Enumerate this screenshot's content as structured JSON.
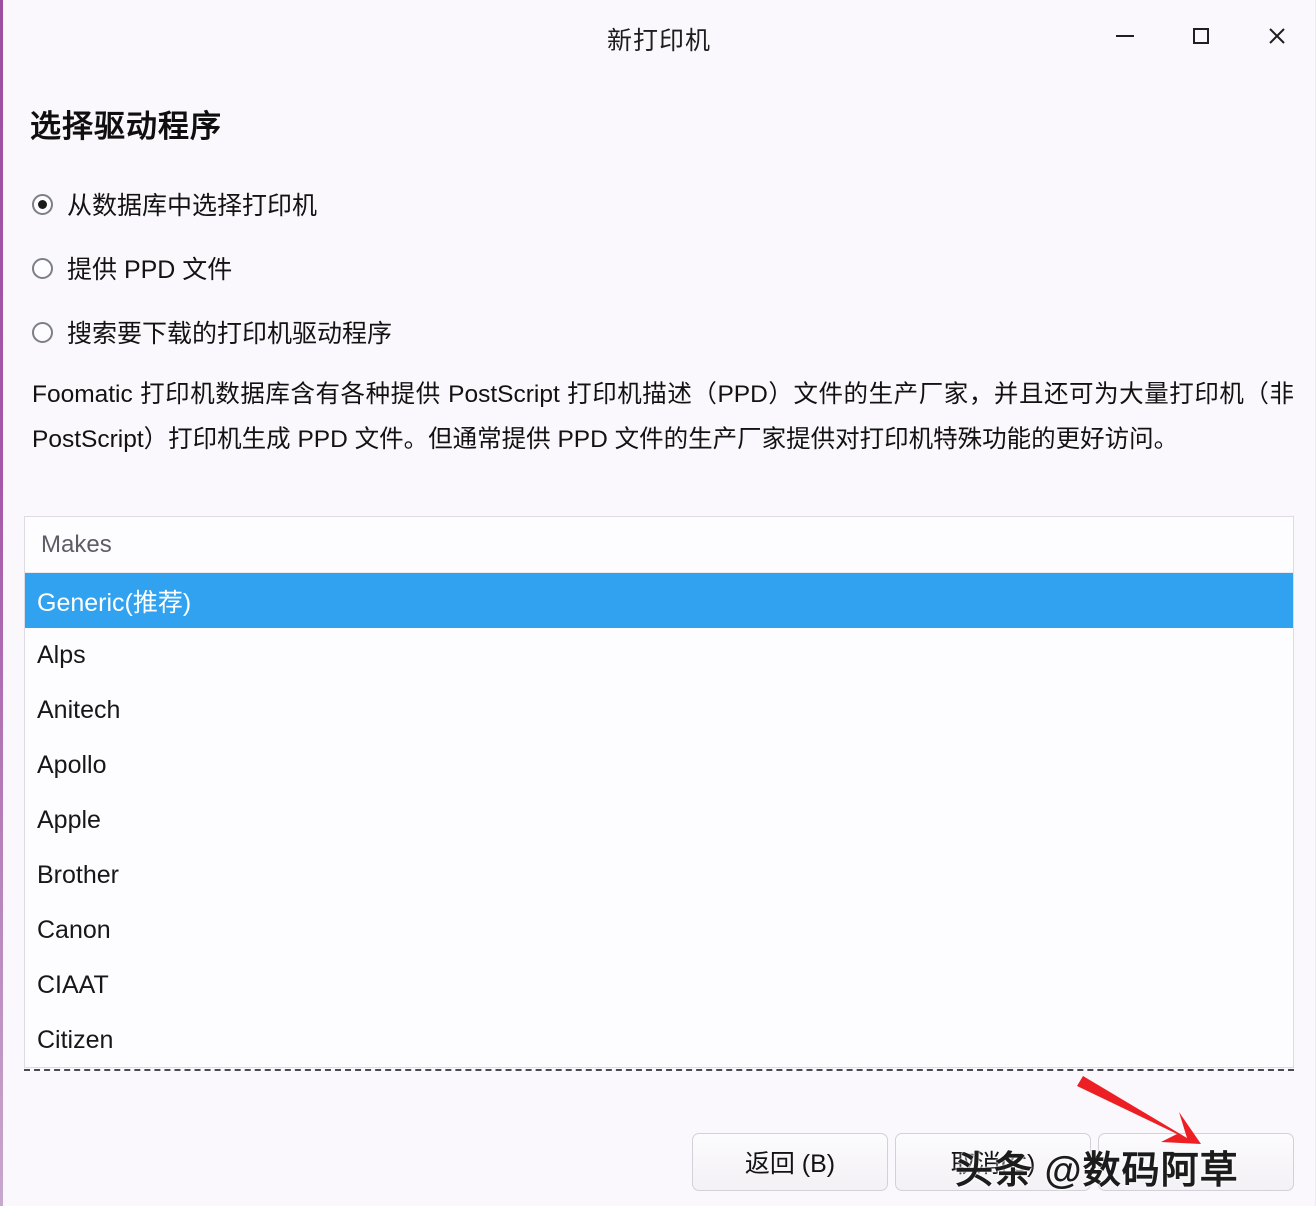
{
  "window": {
    "title": "新打印机",
    "controls": [
      {
        "name": "minimize",
        "glyph": "−"
      },
      {
        "name": "maximize",
        "glyph": "□"
      },
      {
        "name": "close",
        "glyph": "×"
      }
    ],
    "accent_edge_color": "#9b4f9e",
    "background_color": "#faf8fc"
  },
  "page": {
    "heading": "选择驱动程序",
    "description": "Foomatic 打印机数据库含有各种提供 PostScript 打印机描述（PPD）文件的生产厂家，并且还可为大量打印机（非 PostScript）打印机生成 PPD 文件。但通常提供 PPD 文件的生产厂家提供对打印机特殊功能的更好访问。"
  },
  "driver_source": {
    "options": [
      {
        "label": "从数据库中选择打印机",
        "selected": true
      },
      {
        "label": "提供 PPD 文件",
        "selected": false
      },
      {
        "label": "搜索要下载的打印机驱动程序",
        "selected": false
      }
    ]
  },
  "makes_list": {
    "column_header": "Makes",
    "selection_color": "#30a2ef",
    "selected_index": 0,
    "items": [
      {
        "label": "Generic(推荐)",
        "selected": true
      },
      {
        "label": "Alps",
        "selected": false
      },
      {
        "label": "Anitech",
        "selected": false
      },
      {
        "label": "Apollo",
        "selected": false
      },
      {
        "label": "Apple",
        "selected": false
      },
      {
        "label": "Brother",
        "selected": false
      },
      {
        "label": "Canon",
        "selected": false
      },
      {
        "label": "CIAAT",
        "selected": false
      },
      {
        "label": "Citizen",
        "selected": false
      }
    ]
  },
  "footer": {
    "buttons": [
      {
        "label": "返回 (B)",
        "name": "back"
      },
      {
        "label": "取消(C)",
        "name": "cancel"
      },
      {
        "label": "",
        "name": "forward"
      }
    ]
  },
  "overlay": {
    "watermark_text": "头条 @数码阿草",
    "arrow_color": "#ec2024"
  }
}
